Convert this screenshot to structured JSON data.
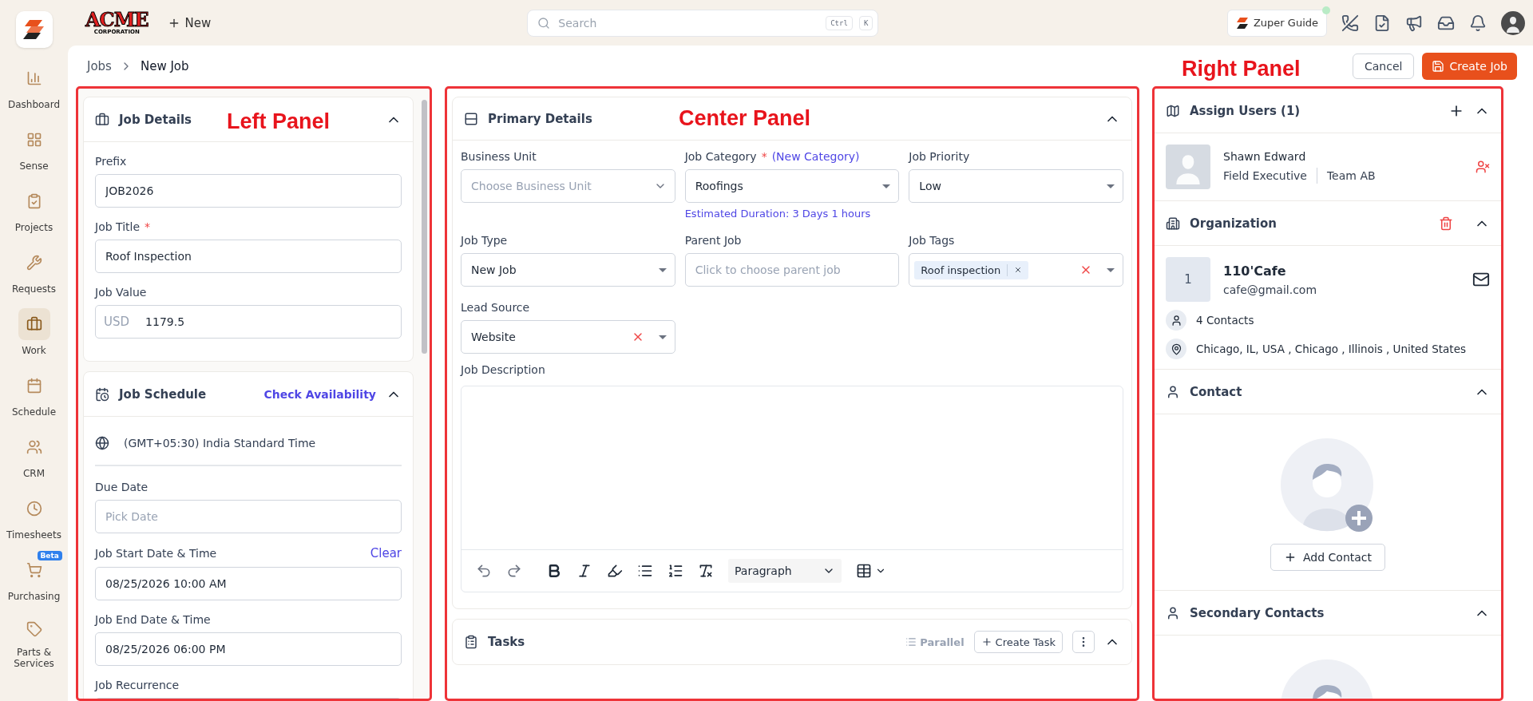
{
  "sidebar": {
    "items": [
      {
        "label": "Dashboard",
        "selected": false
      },
      {
        "label": "Sense",
        "selected": false
      },
      {
        "label": "Projects",
        "selected": false
      },
      {
        "label": "Requests",
        "selected": false
      },
      {
        "label": "Work",
        "selected": true
      },
      {
        "label": "Schedule",
        "selected": false
      },
      {
        "label": "CRM",
        "selected": false
      },
      {
        "label": "Timesheets",
        "selected": false
      },
      {
        "label": "Purchasing",
        "selected": false,
        "badge": "Beta"
      },
      {
        "label": "Parts & Services",
        "selected": false
      }
    ]
  },
  "topbar": {
    "logo": {
      "title": "ACME",
      "subtitle": "CORPORATION"
    },
    "new_button": "New",
    "search": {
      "placeholder": "Search",
      "keys": [
        "Ctrl",
        "K"
      ]
    },
    "guide_button": "Zuper Guide"
  },
  "breadcrumb": [
    "Jobs",
    "New Job"
  ],
  "actions": {
    "cancel": "Cancel",
    "create": "Create Job"
  },
  "annotations": [
    "Left Panel",
    "Center Panel",
    "Right Panel"
  ],
  "left_panel": {
    "job_details": {
      "title": "Job Details",
      "expanded": true,
      "fields": [
        {
          "label": "Prefix",
          "value": "JOB2026"
        },
        {
          "label": "Job Title",
          "value": "Roof Inspection",
          "required": "*"
        },
        {
          "label": "Job Value",
          "prefix": "USD",
          "value": "1179.5"
        }
      ]
    },
    "job_schedule": {
      "title": "Job Schedule",
      "expanded": true,
      "link": "Check Availability",
      "timezone": "(GMT+05:30) India Standard Time",
      "fields": [
        {
          "label": "Due Date",
          "placeholder": "Pick Date"
        },
        {
          "label": "Job Start Date & Time",
          "action": "Clear",
          "value": "08/25/2026 10:00 AM"
        },
        {
          "label": "Job End Date & Time",
          "value": "08/25/2026 06:00 PM"
        },
        {
          "label": "Job Recurrence"
        }
      ]
    }
  },
  "center_panel": {
    "primary_details": {
      "title": "Primary Details",
      "expanded": true,
      "fields": [
        {
          "kind": "select",
          "label": "Business Unit",
          "placeholder": "Choose Business Unit"
        },
        {
          "kind": "select",
          "label": "Job Category",
          "required": "*",
          "link": "(New Category)",
          "value": "Roofings",
          "hint": "Estimated Duration: 3 Days 1 hours"
        },
        {
          "kind": "select",
          "label": "Job Priority",
          "value": "Low"
        },
        {
          "kind": "select",
          "label": "Job Type",
          "value": "New Job"
        },
        {
          "kind": "text",
          "label": "Parent Job",
          "placeholder": "Click to choose parent job"
        },
        {
          "kind": "tags",
          "label": "Job Tags",
          "tags": [
            "Roof inspection"
          ],
          "clearable": true
        },
        {
          "kind": "select",
          "label": "Lead Source",
          "value": "Website",
          "clearable": true
        }
      ],
      "description": {
        "label": "Job Description",
        "format": "Paragraph"
      }
    },
    "tasks": {
      "title": "Tasks",
      "expanded": true,
      "mode": "Parallel",
      "create": "Create Task"
    }
  },
  "right_panel": {
    "assign_users": {
      "title": "Assign Users (1)",
      "expanded": true,
      "users": [
        {
          "name": "Shawn Edward",
          "role": "Field Executive",
          "team": "Team AB"
        }
      ]
    },
    "organization": {
      "title": "Organization",
      "expanded": true,
      "avatar": "1",
      "name": "110'Cafe",
      "email": "cafe@gmail.com",
      "contacts": "4 Contacts",
      "address": "Chicago, IL, USA , Chicago , Illinois , United States"
    },
    "contact": {
      "title": "Contact",
      "expanded": true,
      "button": "Add Contact"
    },
    "secondary_contacts": {
      "title": "Secondary Contacts",
      "expanded": true
    }
  }
}
